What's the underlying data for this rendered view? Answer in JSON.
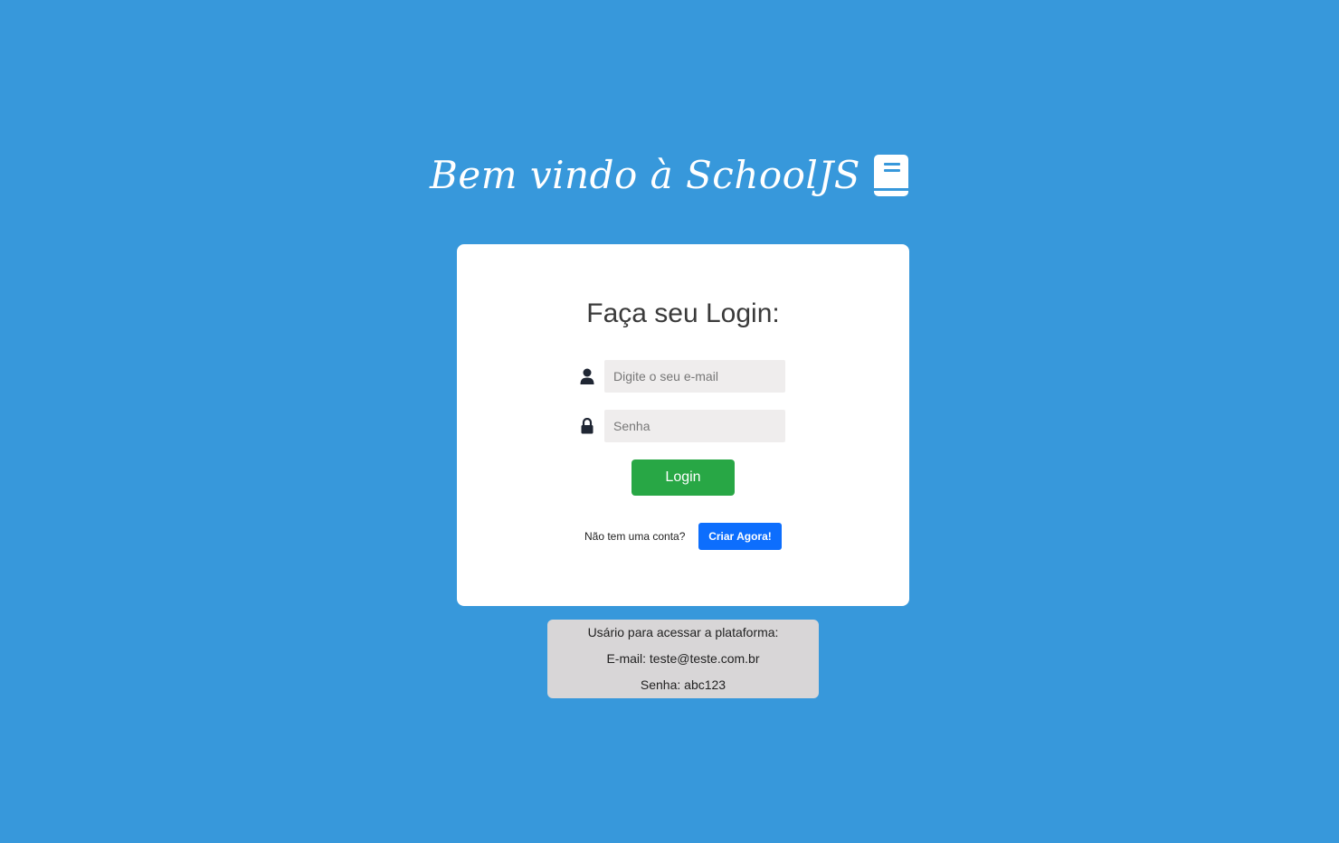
{
  "header": {
    "title": "Bem vindo à SchoolJS",
    "icon": "book-icon"
  },
  "login_form": {
    "title": "Faça seu Login:",
    "email": {
      "icon": "user-icon",
      "placeholder": "Digite o seu e-mail",
      "value": ""
    },
    "password": {
      "icon": "lock-icon",
      "placeholder": "Senha",
      "value": ""
    },
    "submit_label": "Login",
    "signup_prompt": "Não tem uma conta?",
    "signup_label": "Criar Agora!"
  },
  "test_user": {
    "heading": "Usário para acessar a plataforma:",
    "email_line": "E-mail: teste@teste.com.br",
    "password_line": "Senha: abc123"
  },
  "colors": {
    "background": "#3798db",
    "card": "#ffffff",
    "login_button": "#28a745",
    "signup_button": "#0d6efd",
    "info_box": "#d8d6d7"
  }
}
